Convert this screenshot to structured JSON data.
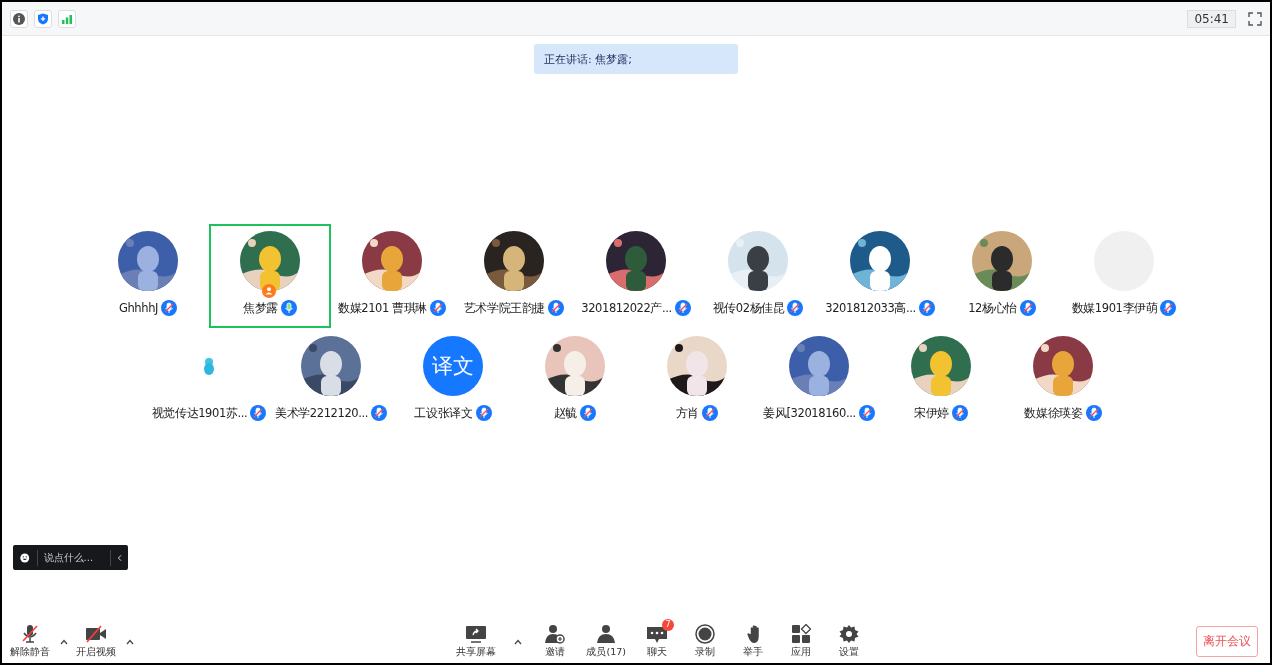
{
  "top_bar": {
    "timer": "05:41"
  },
  "speaking_banner": "正在讲话: 焦梦露;",
  "participants": [
    {
      "name": "GhhhhJ",
      "muted": true,
      "selected": false,
      "host": false
    },
    {
      "name": "焦梦露",
      "muted": false,
      "selected": true,
      "host": true
    },
    {
      "name": "数媒2101 曹琪琳",
      "muted": true,
      "selected": false,
      "host": false
    },
    {
      "name": "艺术学院王韵捷",
      "muted": true,
      "selected": false,
      "host": false
    },
    {
      "name": "3201812022产...",
      "muted": true,
      "selected": false,
      "host": false
    },
    {
      "name": "视传02杨佳昆",
      "muted": true,
      "selected": false,
      "host": false
    },
    {
      "name": "3201812033高...",
      "muted": true,
      "selected": false,
      "host": false
    },
    {
      "name": "12杨心怡",
      "muted": true,
      "selected": false,
      "host": false
    },
    {
      "name": "数媒1901李伊萌",
      "muted": true,
      "selected": false,
      "host": false,
      "avatar": {
        "kind": "blank"
      }
    },
    {
      "name": "视觉传达1901苏...",
      "muted": true,
      "selected": false,
      "host": false,
      "avatar": {
        "kind": "sticker"
      }
    },
    {
      "name": "美术学2212120...",
      "muted": true,
      "selected": false,
      "host": false
    },
    {
      "name": "工设张译文",
      "muted": true,
      "selected": false,
      "host": false,
      "avatar": {
        "kind": "text",
        "text": "译文"
      }
    },
    {
      "name": "赵毓",
      "muted": true,
      "selected": false,
      "host": false
    },
    {
      "name": "方肖",
      "muted": true,
      "selected": false,
      "host": false
    },
    {
      "name": "姜风[32018160...",
      "muted": true,
      "selected": false,
      "host": false
    },
    {
      "name": "宋伊婷",
      "muted": true,
      "selected": false,
      "host": false
    },
    {
      "name": "数媒徐瑛姿",
      "muted": true,
      "selected": false,
      "host": false
    }
  ],
  "chat_input": {
    "placeholder": "说点什么..."
  },
  "toolbar_left": [
    {
      "kind": "mic",
      "label": "解除静音",
      "off": true,
      "has_menu": true
    },
    {
      "kind": "video",
      "label": "开启视频",
      "off": true,
      "has_menu": true
    }
  ],
  "toolbar_center": [
    {
      "kind": "share",
      "label": "共享屏幕",
      "has_menu": true
    },
    {
      "kind": "invite",
      "label": "邀请",
      "has_menu": false
    },
    {
      "kind": "members",
      "label": "成员(17)",
      "has_menu": false
    },
    {
      "kind": "chat",
      "label": "聊天",
      "has_menu": false,
      "badge": "7"
    },
    {
      "kind": "record",
      "label": "录制",
      "has_menu": false
    },
    {
      "kind": "hand",
      "label": "举手",
      "has_menu": false
    },
    {
      "kind": "apps",
      "label": "应用",
      "has_menu": false
    },
    {
      "kind": "settings",
      "label": "设置",
      "has_menu": false
    }
  ],
  "leave_button": "离开会议"
}
